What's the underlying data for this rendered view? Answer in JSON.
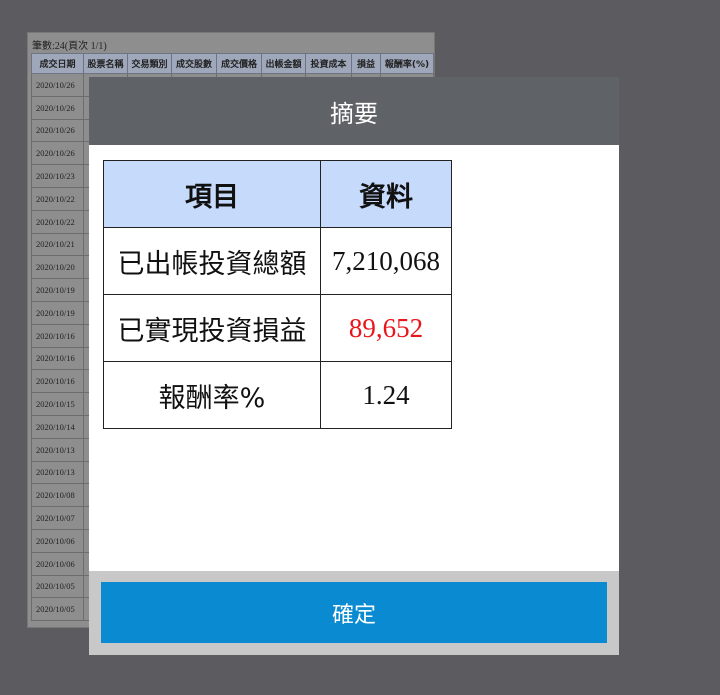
{
  "background": {
    "record_count": "筆數:24(頁次 1/1)",
    "columns": [
      "成交日期",
      "股票名稱",
      "交易類別",
      "成交股數",
      "成交價格",
      "出帳金額",
      "投資成本",
      "損益",
      "報酬率(%)"
    ],
    "dates": [
      "2020/10/26",
      "2020/10/26",
      "2020/10/26",
      "2020/10/26",
      "2020/10/23",
      "2020/10/22",
      "2020/10/22",
      "2020/10/21",
      "2020/10/20",
      "2020/10/19",
      "2020/10/19",
      "2020/10/16",
      "2020/10/16",
      "2020/10/16",
      "2020/10/15",
      "2020/10/14",
      "2020/10/13",
      "2020/10/13",
      "2020/10/08",
      "2020/10/07",
      "2020/10/06",
      "2020/10/06",
      "2020/10/05",
      "2020/10/05"
    ]
  },
  "modal": {
    "title": "摘要",
    "table": {
      "header_item": "項目",
      "header_data": "資料",
      "rows": [
        {
          "item": "已出帳投資總額",
          "value": "7,210,068",
          "color": "#111111"
        },
        {
          "item": "已實現投資損益",
          "value": "89,652",
          "color": "#e8161b"
        },
        {
          "item": "報酬率%",
          "value": "1.24",
          "color": "#111111"
        }
      ]
    },
    "confirm_label": "確定"
  }
}
